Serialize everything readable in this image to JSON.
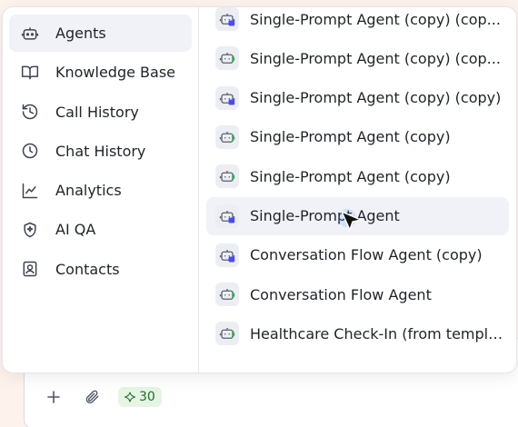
{
  "sidebar": {
    "items": [
      {
        "label": "Agents",
        "icon": "agent-bot-icon",
        "active": true
      },
      {
        "label": "Knowledge Base",
        "icon": "book-open-icon"
      },
      {
        "label": "Call History",
        "icon": "history-icon"
      },
      {
        "label": "Chat History",
        "icon": "clock-icon"
      },
      {
        "label": "Analytics",
        "icon": "line-chart-icon"
      },
      {
        "label": "AI QA",
        "icon": "ai-shield-icon"
      },
      {
        "label": "Contacts",
        "icon": "contact-card-icon"
      }
    ]
  },
  "agents": {
    "items": [
      {
        "name": "Single-Prompt Agent (copy) (cop...",
        "type": "single-prompt"
      },
      {
        "name": "Single-Prompt Agent (copy) (cop...",
        "type": "conversation-flow"
      },
      {
        "name": "Single-Prompt Agent (copy) (copy)",
        "type": "single-prompt"
      },
      {
        "name": "Single-Prompt Agent (copy)",
        "type": "conversation-flow"
      },
      {
        "name": "Single-Prompt Agent (copy)",
        "type": "conversation-flow"
      },
      {
        "name": "Single-Prompt Agent",
        "type": "single-prompt",
        "hovered": true
      },
      {
        "name": "Conversation Flow Agent (copy)",
        "type": "single-prompt"
      },
      {
        "name": "Conversation Flow Agent",
        "type": "conversation-flow"
      },
      {
        "name": "Healthcare Check-In (from templa...",
        "type": "conversation-flow"
      }
    ]
  },
  "composer": {
    "credits": "30",
    "icons": [
      "plus-icon",
      "paperclip-icon",
      "sparkle-icon"
    ]
  },
  "colors": {
    "single_prompt_badge": "#4a4ee8",
    "conversation_flow_badge": "#2fb34a",
    "credit_bg": "#e6f4e3",
    "credit_text": "#1f6b2c"
  }
}
